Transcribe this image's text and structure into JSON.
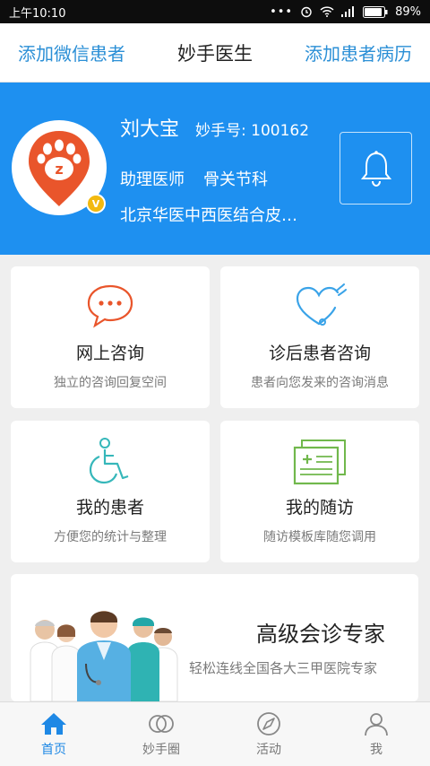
{
  "statusbar": {
    "time": "上午10:10",
    "battery": "89%"
  },
  "nav": {
    "left": "添加微信患者",
    "title": "妙手医生",
    "right": "添加患者病历"
  },
  "profile": {
    "name": "刘大宝",
    "id": "妙手号: 100162",
    "title": "助理医师",
    "department": "骨关节科",
    "hospital": "北京华医中西医结合皮…",
    "badge": "V"
  },
  "cards": [
    {
      "title": "网上咨询",
      "subtitle": "独立的咨询回复空间",
      "icon": "chat-bubble-icon"
    },
    {
      "title": "诊后患者咨询",
      "subtitle": "患者向您发来的咨询消息",
      "icon": "heart-message-icon"
    },
    {
      "title": "我的患者",
      "subtitle": "方便您的统计与整理",
      "icon": "wheelchair-icon"
    },
    {
      "title": "我的随访",
      "subtitle": "随访模板库随您调用",
      "icon": "medical-records-icon"
    }
  ],
  "banner": {
    "title": "高级会诊专家",
    "subtitle": "轻松连线全国各大三甲医院专家"
  },
  "tabs": [
    {
      "label": "首页",
      "icon": "home-icon",
      "active": true
    },
    {
      "label": "妙手圈",
      "icon": "circles-icon",
      "active": false
    },
    {
      "label": "活动",
      "icon": "compass-icon",
      "active": false
    },
    {
      "label": "我",
      "icon": "person-icon",
      "active": false
    }
  ],
  "colors": {
    "primary": "#1e90f0",
    "accent_orange": "#e9552b",
    "icon_blue": "#3aa3e8",
    "icon_green": "#71b84c",
    "icon_teal": "#36b7ba"
  }
}
